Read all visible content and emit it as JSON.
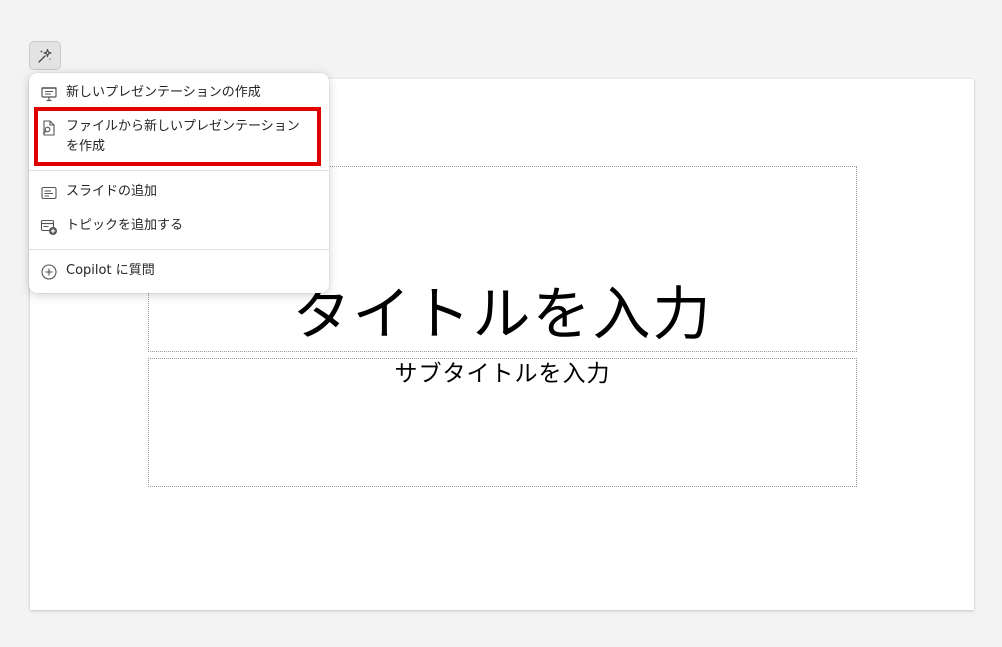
{
  "copilot_button": {
    "icon": "sparkle-wand-icon"
  },
  "menu": {
    "items": [
      {
        "label": "新しいプレゼンテーションの作成",
        "icon": "presentation-icon"
      },
      {
        "label": "ファイルから新しいプレゼンテーションを作成",
        "icon": "file-search-icon"
      },
      {
        "label": "スライドの追加",
        "icon": "slide-icon"
      },
      {
        "label": "トピックを追加する",
        "icon": "add-topic-icon"
      },
      {
        "label": "Copilot に質問",
        "icon": "add-circle-icon"
      }
    ]
  },
  "slide": {
    "title_placeholder": "タイトルを入力",
    "subtitle_placeholder": "サブタイトルを入力"
  },
  "colors": {
    "highlight": "#e00000",
    "background": "#f3f3f3",
    "slide": "#ffffff"
  }
}
